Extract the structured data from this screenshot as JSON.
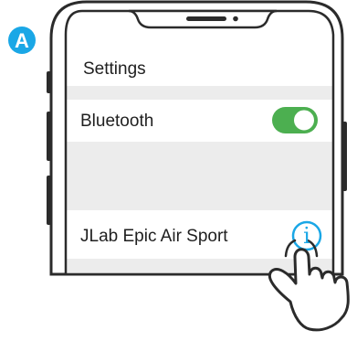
{
  "step": {
    "badge": "A",
    "badge_color": "#1aa7e6"
  },
  "phone": {
    "settings_title": "Settings",
    "bluetooth_label": "Bluetooth",
    "bluetooth_enabled": true,
    "toggle_color": "#4caf50",
    "device_name": "JLab Epic Air Sport",
    "info_icon": "info-icon",
    "info_glyph": "i",
    "info_color": "#1aa7e6"
  },
  "gesture": {
    "icon": "tap-hand-icon"
  }
}
